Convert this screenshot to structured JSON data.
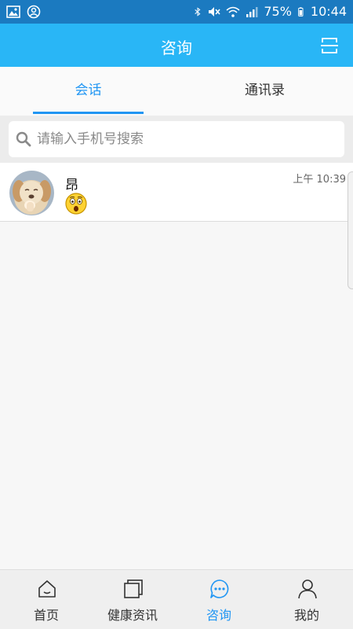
{
  "status_bar": {
    "battery": "75%",
    "time": "10:44",
    "icons": [
      "image-icon",
      "account-circle-icon",
      "bluetooth-icon",
      "mute-icon",
      "wifi-icon",
      "signal-icon",
      "battery-icon"
    ]
  },
  "app_bar": {
    "title": "咨询",
    "action_icon": "scan-icon"
  },
  "tabs": [
    {
      "label": "会话",
      "active": true
    },
    {
      "label": "通讯录",
      "active": false
    }
  ],
  "search": {
    "placeholder": "请输入手机号搜索",
    "value": ""
  },
  "conversations": [
    {
      "name": "昂",
      "time": "上午 10:39",
      "last_message_icon": "surprised-emoji-icon"
    }
  ],
  "bottom_nav": [
    {
      "label": "首页",
      "icon": "home-icon",
      "active": false
    },
    {
      "label": "健康资讯",
      "icon": "news-icon",
      "active": false
    },
    {
      "label": "咨询",
      "icon": "chat-icon",
      "active": true
    },
    {
      "label": "我的",
      "icon": "person-icon",
      "active": false
    }
  ],
  "colors": {
    "status_bar": "#1b7ac0",
    "app_bar": "#29b6f6",
    "accent": "#2196f3"
  }
}
